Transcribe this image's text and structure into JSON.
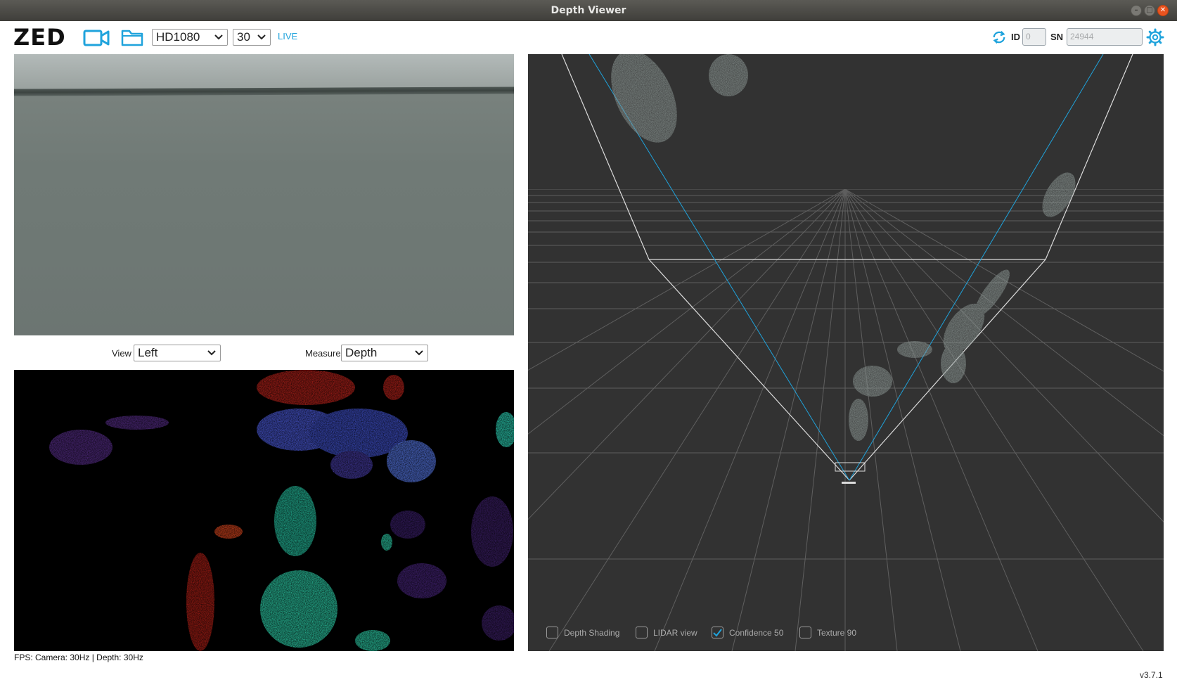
{
  "window": {
    "title": "Depth Viewer"
  },
  "toolbar": {
    "logo": "ZED",
    "resolution": "HD1080",
    "fps": "30",
    "live_label": "LIVE",
    "id_label": "ID",
    "id_value": "0",
    "sn_label": "SN",
    "sn_value": "24944",
    "icons": [
      "camera-icon",
      "folder-icon",
      "sync-icon",
      "gear-icon"
    ],
    "accent_color": "#1fa3dc"
  },
  "view_controls": {
    "view_label": "View",
    "view_value": "Left",
    "measure_label": "Measure",
    "measure_value": "Depth"
  },
  "status": {
    "fps_text": "FPS: Camera: 30Hz | Depth: 30Hz"
  },
  "pointcloud": {
    "options": [
      {
        "label": "Depth Shading",
        "checked": false
      },
      {
        "label": "LIDAR view",
        "checked": false
      },
      {
        "label": "Confidence 50",
        "checked": true
      },
      {
        "label": "Texture 90",
        "checked": false
      }
    ]
  },
  "footer": {
    "version": "v3.7.1"
  }
}
